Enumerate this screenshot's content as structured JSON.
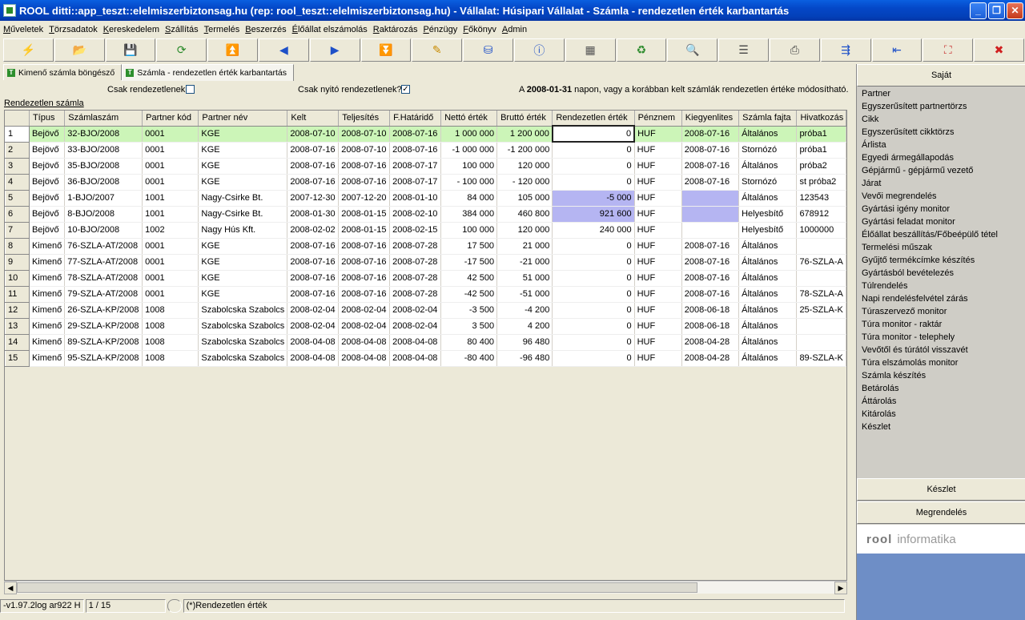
{
  "window": {
    "title": "ROOL ditti::app_teszt::elelmiszerbiztonsag.hu (rep: rool_teszt::elelmiszerbiztonsag.hu) - Vállalat: Húsipari Vállalat - Számla - rendezetlen érték karbantartás",
    "min": "_",
    "max": "❐",
    "close": "✕"
  },
  "menu": [
    "Műveletek",
    "Törzsadatok",
    "Kereskedelem",
    "Szállítás",
    "Termelés",
    "Beszerzés",
    "Élőállat elszámolás",
    "Raktározás",
    "Pénzügy",
    "Főkönyv",
    "Admin"
  ],
  "toolbar": [
    {
      "icon": "lightning-icon",
      "glyph": "⚡",
      "color": "#d0a000"
    },
    {
      "icon": "open-folder-icon",
      "glyph": "📂",
      "color": "#3355aa"
    },
    {
      "icon": "save-icon",
      "glyph": "💾",
      "color": "#333366"
    },
    {
      "icon": "refresh-green-icon",
      "glyph": "⟳",
      "color": "#2a8a2a"
    },
    {
      "icon": "first-icon",
      "glyph": "⏫",
      "color": "#1e50c8"
    },
    {
      "icon": "prev-icon",
      "glyph": "◀",
      "color": "#1e50c8"
    },
    {
      "icon": "next-icon",
      "glyph": "▶",
      "color": "#1e50c8"
    },
    {
      "icon": "last-icon",
      "glyph": "⏬",
      "color": "#1e50c8"
    },
    {
      "icon": "edit-icon",
      "glyph": "✎",
      "color": "#c88a00"
    },
    {
      "icon": "database-icon",
      "glyph": "⛁",
      "color": "#1e50c8"
    },
    {
      "icon": "info-icon",
      "glyph": "ⓘ",
      "color": "#1e50c8"
    },
    {
      "icon": "window-icon",
      "glyph": "▦",
      "color": "#555"
    },
    {
      "icon": "recycle-icon",
      "glyph": "♻",
      "color": "#2a8a2a"
    },
    {
      "icon": "search-icon",
      "glyph": "🔍",
      "color": "#333"
    },
    {
      "icon": "list-icon",
      "glyph": "☰",
      "color": "#444"
    },
    {
      "icon": "print-icon",
      "glyph": "⎙",
      "color": "#444"
    },
    {
      "icon": "export-icon",
      "glyph": "⇶",
      "color": "#1e50c8"
    },
    {
      "icon": "import-icon",
      "glyph": "⇤",
      "color": "#1e50c8"
    },
    {
      "icon": "fit-icon",
      "glyph": "⛶",
      "color": "#c83030"
    },
    {
      "icon": "close-icon",
      "glyph": "✖",
      "color": "#d02020"
    }
  ],
  "tabs": [
    {
      "label": "Kimenő számla böngésző",
      "active": false
    },
    {
      "label": "Számla - rendezetlen érték karbantartás",
      "active": true
    }
  ],
  "options": {
    "csak_rendezetlenek": "Csak rendezetlenek",
    "csak_nyito": "Csak nyitó rendezetlenek?",
    "check_mark": "✓",
    "info_prefix": "A ",
    "info_date": "2008-01-31",
    "info_suffix": " napon, vagy a korábban kelt számlák rendezetlen értéke módosítható."
  },
  "grid": {
    "label": "Rendezetlen számla",
    "columns": [
      "Típus",
      "Számlaszám",
      "Partner kód",
      "Partner név",
      "Kelt",
      "Teljesítés",
      "F.Határidő",
      "Nettó érték",
      "Bruttó érték",
      "Rendezetlen érték",
      "Pénznem",
      "Kiegyenlites",
      "Számla fajta",
      "Hivatkozás"
    ],
    "rows": [
      [
        "1",
        "Bejövő",
        "32-BJO/2008",
        "0001",
        "KGE",
        "2008-07-10",
        "2008-07-10",
        "2008-07-16",
        "1 000 000",
        "1 200 000",
        "0",
        "HUF",
        "2008-07-16",
        "Általános",
        "próba1"
      ],
      [
        "2",
        "Bejövő",
        "33-BJO/2008",
        "0001",
        "KGE",
        "2008-07-16",
        "2008-07-10",
        "2008-07-16",
        "-1 000 000",
        "-1 200 000",
        "0",
        "HUF",
        "2008-07-16",
        "Stornózó",
        "próba1"
      ],
      [
        "3",
        "Bejövő",
        "35-BJO/2008",
        "0001",
        "KGE",
        "2008-07-16",
        "2008-07-16",
        "2008-07-17",
        "100 000",
        "120 000",
        "0",
        "HUF",
        "2008-07-16",
        "Általános",
        "próba2"
      ],
      [
        "4",
        "Bejövő",
        "36-BJO/2008",
        "0001",
        "KGE",
        "2008-07-16",
        "2008-07-16",
        "2008-07-17",
        "- 100 000",
        "- 120 000",
        "0",
        "HUF",
        "2008-07-16",
        "Stornózó",
        "st próba2"
      ],
      [
        "5",
        "Bejövő",
        "1-BJO/2007",
        "1001",
        "Nagy-Csirke Bt.",
        "2007-12-30",
        "2007-12-20",
        "2008-01-10",
        "84 000",
        "105 000",
        "-5 000",
        "HUF",
        "",
        "Általános",
        "123543"
      ],
      [
        "6",
        "Bejövő",
        "8-BJO/2008",
        "1001",
        "Nagy-Csirke Bt.",
        "2008-01-30",
        "2008-01-15",
        "2008-02-10",
        "384 000",
        "460 800",
        "921 600",
        "HUF",
        "",
        "Helyesbítő",
        "678912"
      ],
      [
        "7",
        "Bejövő",
        "10-BJO/2008",
        "1002",
        "Nagy Hús Kft.",
        "2008-02-02",
        "2008-01-15",
        "2008-02-15",
        "100 000",
        "120 000",
        "240 000",
        "HUF",
        "",
        "Helyesbítő",
        "1000000"
      ],
      [
        "8",
        "Kimenő",
        "76-SZLA-AT/2008",
        "0001",
        "KGE",
        "2008-07-16",
        "2008-07-16",
        "2008-07-28",
        "17 500",
        "21 000",
        "0",
        "HUF",
        "2008-07-16",
        "Általános",
        ""
      ],
      [
        "9",
        "Kimenő",
        "77-SZLA-AT/2008",
        "0001",
        "KGE",
        "2008-07-16",
        "2008-07-16",
        "2008-07-28",
        "-17 500",
        "-21 000",
        "0",
        "HUF",
        "2008-07-16",
        "Általános",
        "76-SZLA-A"
      ],
      [
        "10",
        "Kimenő",
        "78-SZLA-AT/2008",
        "0001",
        "KGE",
        "2008-07-16",
        "2008-07-16",
        "2008-07-28",
        "42 500",
        "51 000",
        "0",
        "HUF",
        "2008-07-16",
        "Általános",
        ""
      ],
      [
        "11",
        "Kimenő",
        "79-SZLA-AT/2008",
        "0001",
        "KGE",
        "2008-07-16",
        "2008-07-16",
        "2008-07-28",
        "-42 500",
        "-51 000",
        "0",
        "HUF",
        "2008-07-16",
        "Általános",
        "78-SZLA-A"
      ],
      [
        "12",
        "Kimenő",
        "26-SZLA-KP/2008",
        "1008",
        "Szabolcska Szabolcs",
        "2008-02-04",
        "2008-02-04",
        "2008-02-04",
        "-3 500",
        "-4 200",
        "0",
        "HUF",
        "2008-06-18",
        "Általános",
        "25-SZLA-K"
      ],
      [
        "13",
        "Kimenő",
        "29-SZLA-KP/2008",
        "1008",
        "Szabolcska Szabolcs",
        "2008-02-04",
        "2008-02-04",
        "2008-02-04",
        "3 500",
        "4 200",
        "0",
        "HUF",
        "2008-06-18",
        "Általános",
        ""
      ],
      [
        "14",
        "Kimenő",
        "89-SZLA-KP/2008",
        "1008",
        "Szabolcska Szabolcs",
        "2008-04-08",
        "2008-04-08",
        "2008-04-08",
        "80 400",
        "96 480",
        "0",
        "HUF",
        "2008-04-28",
        "Általános",
        ""
      ],
      [
        "15",
        "Kimenő",
        "95-SZLA-KP/2008",
        "1008",
        "Szabolcska Szabolcs",
        "2008-04-08",
        "2008-04-08",
        "2008-04-08",
        "-80 400",
        "-96 480",
        "0",
        "HUF",
        "2008-04-28",
        "Általános",
        "89-SZLA-K"
      ]
    ]
  },
  "status": {
    "version": "-v1.97.2log ar922 H",
    "record": "1 / 15",
    "note": "(*)Rendezetlen érték"
  },
  "right_panel": {
    "sajat": "Saját",
    "items": [
      "Partner",
      "Egyszerűsített partnertörzs",
      "Cikk",
      "Egyszerűsített cikktörzs",
      "Árlista",
      "Egyedi ármegállapodás",
      "Gépjármű - gépjármű vezető",
      "Járat",
      "Vevői megrendelés",
      "Gyártási igény monitor",
      "Gyártási feladat monitor",
      "Élőállat beszállítás/Főbeépülő tétel",
      "Termelési műszak",
      "Gyűjtő termékcímke készítés",
      "Gyártásból bevételezés",
      "Túlrendelés",
      "Napi rendelésfelvétel zárás",
      "Túraszervező monitor",
      "Túra monitor - raktár",
      "Túra monitor - telephely",
      "Vevőtől és túrától visszavét",
      "Túra elszámolás monitor",
      "Számla készítés",
      "Betárolás",
      "Áttárolás",
      "Kitárolás",
      "Készlet"
    ],
    "keszlet": "Készlet",
    "megrendeles": "Megrendelés",
    "logo_brand": "rool",
    "logo_text": "informatika"
  }
}
